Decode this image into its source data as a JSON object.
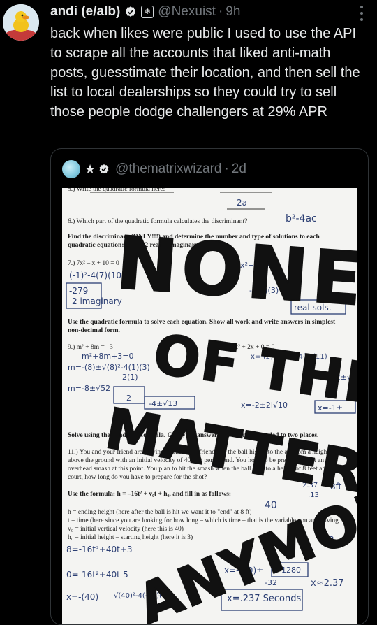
{
  "post": {
    "display_name": "andi (e/alb)",
    "handle": "@Nexuist",
    "separator": "·",
    "time": "9h",
    "badge_glyph": "❄",
    "text": "back when likes were public I used to use the API to scrape all the accounts that liked anti-math posts, guesstimate their location, and then sell the list to local dealerships so they could try to sell those people dodge challengers at 29% APR"
  },
  "quote": {
    "handle": "@thematrixwizard",
    "separator": "·",
    "time": "2d"
  },
  "worksheet": {
    "lines": [
      {
        "id": "q5",
        "text": "5.) Write the quadratic formula here:",
        "bold": false
      },
      {
        "id": "q6",
        "text": "6.) Which part of the quadratic formula calculates the discriminant?",
        "bold": false
      },
      {
        "id": "find1",
        "text": "Find the discriminant (ONLY!!!) and determine the number and type of solutions to each",
        "bold": true
      },
      {
        "id": "find2",
        "text": "quadratic equation: 1 real, 2 real, 2 imaginary",
        "bold": true
      },
      {
        "id": "q7",
        "text": "7.) 7x² – x + 10 = 0",
        "bold": false
      },
      {
        "id": "use1",
        "text": "Use the quadratic formula to solve each equation. Show all work and write answers in simplest",
        "bold": true
      },
      {
        "id": "use2",
        "text": "non-decimal form.",
        "bold": true
      },
      {
        "id": "q9",
        "text": "9.) m² + 8m = –3",
        "bold": false
      },
      {
        "id": "q10",
        "text": "10.) x² + 2x + 0 = 0",
        "bold": false
      },
      {
        "id": "solve",
        "text": "Solve using the quadratic formula. Give your answer as a decimal rounded to two places.",
        "bold": true
      },
      {
        "id": "q11a",
        "text": "11.) You and your friend are playing tennis. Your friend hits the ball high into the air from a height of 3 feet",
        "bold": false
      },
      {
        "id": "q11b",
        "text": "above the ground with an initial velocity of 40 feet per second. You hope to be prepared to hit an",
        "bold": false
      },
      {
        "id": "q11c",
        "text": "overhead smash at this point. You plan to hit the smash when the ball falls to a height of 8 feet above the",
        "bold": false
      },
      {
        "id": "q11d",
        "text": "court, how long do you have to prepare for the shot?",
        "bold": false
      },
      {
        "id": "formula",
        "text": "Use the formula: h = –16t² + v₀t + h₀, and fill in as follows:",
        "bold": true
      },
      {
        "id": "h1",
        "text": "h = ending height (here after the ball is hit we want it to \"end\" at 8 ft)",
        "bold": false
      },
      {
        "id": "h2",
        "text": "t = time (here since you are looking for how long – which is time – that is the variable you are solving for)",
        "bold": false
      },
      {
        "id": "h3",
        "text": "v₀ = initial vertical velocity (here this is 40)",
        "bold": false
      },
      {
        "id": "h4",
        "text": "h₀ = initial height – starting height (here it is 3)",
        "bold": false
      }
    ],
    "handwriting": [
      "2a",
      "b²-4ac",
      "(-1)²-4(7)(10)",
      "-279",
      "2 imaginary",
      "3x²+4x+3x",
      "-4(3)(3)",
      "real sols.",
      "m²+8m+3=0",
      "m=-(8)±√(8)²-4(1)(3)",
      "2(1)",
      "m=-8±√52",
      "2",
      "x=-(2)±√(2)²-4(1)(11)",
      "x=-2±√",
      "x=-2±2i√10",
      "x=-1±",
      "-4±√13",
      "8=-16t²+40t+3",
      "0=-16t²+40t-5",
      "x=-(40)±",
      "1280",
      "-32",
      "x≈2.37",
      "x=.237 Seconds",
      "8ft",
      "3ft",
      "40",
      "-13",
      "2.37",
      ".13",
      "x=-(40)",
      "√(40)²-4(-16)(-5)"
    ],
    "overlay_words": [
      "NONE",
      "OF THIS",
      "MATTERS",
      "ANYMORE"
    ]
  }
}
